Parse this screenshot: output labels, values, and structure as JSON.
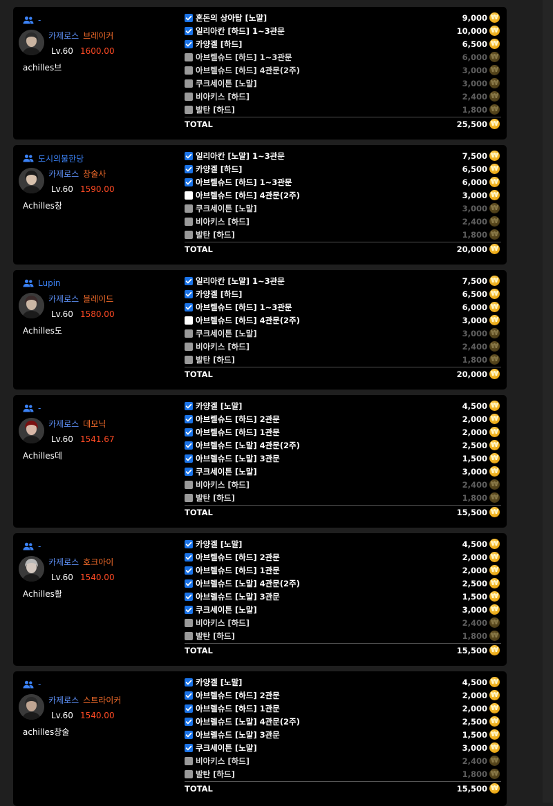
{
  "icons": {
    "party": "party-icon",
    "coin": "gold-coin-icon",
    "check": "check-icon"
  },
  "colors": {
    "server": "#5b8cf0",
    "class": "#f26b2a",
    "item_level": "#ff4a24",
    "party": "#3b82f6",
    "checkbox": "#1a73e8",
    "background": "#000000"
  },
  "characters": [
    {
      "party": "-",
      "server": "카제로스",
      "class": "브레이커",
      "level": "Lv.60",
      "item_level": "1600.00",
      "name": "achilles브",
      "raids": [
        {
          "name": "혼돈의 상아탑 [노말]",
          "gold": "9,000",
          "state": "checked"
        },
        {
          "name": "일리아칸 [하드] 1~3관문",
          "gold": "10,000",
          "state": "checked"
        },
        {
          "name": "카양겔 [하드]",
          "gold": "6,500",
          "state": "checked"
        },
        {
          "name": "아브렐슈드 [하드] 1~3관문",
          "gold": "6,000",
          "state": "disabled"
        },
        {
          "name": "아브렐슈드 [하드] 4관문(2주)",
          "gold": "3,000",
          "state": "disabled"
        },
        {
          "name": "쿠크세이튼 [노말]",
          "gold": "3,000",
          "state": "disabled"
        },
        {
          "name": "비아키스 [하드]",
          "gold": "2,400",
          "state": "disabled"
        },
        {
          "name": "발탄 [하드]",
          "gold": "1,800",
          "state": "disabled"
        }
      ],
      "total_label": "TOTAL",
      "total": "25,500"
    },
    {
      "party": "도시의불한당",
      "server": "카제로스",
      "class": "창술사",
      "level": "Lv.60",
      "item_level": "1590.00",
      "name": "Achilles창",
      "raids": [
        {
          "name": "일리아칸 [노말] 1~3관문",
          "gold": "7,500",
          "state": "checked"
        },
        {
          "name": "카양겔 [하드]",
          "gold": "6,500",
          "state": "checked"
        },
        {
          "name": "아브렐슈드 [하드] 1~3관문",
          "gold": "6,000",
          "state": "checked"
        },
        {
          "name": "아브렐슈드 [하드] 4관문(2주)",
          "gold": "3,000",
          "state": "unchecked"
        },
        {
          "name": "쿠크세이튼 [노말]",
          "gold": "3,000",
          "state": "disabled"
        },
        {
          "name": "비아키스 [하드]",
          "gold": "2,400",
          "state": "disabled"
        },
        {
          "name": "발탄 [하드]",
          "gold": "1,800",
          "state": "disabled"
        }
      ],
      "total_label": "TOTAL",
      "total": "20,000"
    },
    {
      "party": "Lupin",
      "server": "카제로스",
      "class": "블레이드",
      "level": "Lv.60",
      "item_level": "1580.00",
      "name": "Achilles도",
      "raids": [
        {
          "name": "일리아칸 [노말] 1~3관문",
          "gold": "7,500",
          "state": "checked"
        },
        {
          "name": "카양겔 [하드]",
          "gold": "6,500",
          "state": "checked"
        },
        {
          "name": "아브렐슈드 [하드] 1~3관문",
          "gold": "6,000",
          "state": "checked"
        },
        {
          "name": "아브렐슈드 [하드] 4관문(2주)",
          "gold": "3,000",
          "state": "unchecked"
        },
        {
          "name": "쿠크세이튼 [노말]",
          "gold": "3,000",
          "state": "disabled"
        },
        {
          "name": "비아키스 [하드]",
          "gold": "2,400",
          "state": "disabled"
        },
        {
          "name": "발탄 [하드]",
          "gold": "1,800",
          "state": "disabled"
        }
      ],
      "total_label": "TOTAL",
      "total": "20,000"
    },
    {
      "party": "-",
      "server": "카제로스",
      "class": "데모닉",
      "level": "Lv.60",
      "item_level": "1541.67",
      "name": "Achilles데",
      "raids": [
        {
          "name": "카양겔 [노말]",
          "gold": "4,500",
          "state": "checked"
        },
        {
          "name": "아브렐슈드 [하드] 2관문",
          "gold": "2,000",
          "state": "checked"
        },
        {
          "name": "아브렐슈드 [하드] 1관문",
          "gold": "2,000",
          "state": "checked"
        },
        {
          "name": "아브렐슈드 [노말] 4관문(2주)",
          "gold": "2,500",
          "state": "checked"
        },
        {
          "name": "아브렐슈드 [노말] 3관문",
          "gold": "1,500",
          "state": "checked"
        },
        {
          "name": "쿠크세이튼 [노말]",
          "gold": "3,000",
          "state": "checked"
        },
        {
          "name": "비아키스 [하드]",
          "gold": "2,400",
          "state": "disabled"
        },
        {
          "name": "발탄 [하드]",
          "gold": "1,800",
          "state": "disabled"
        }
      ],
      "total_label": "TOTAL",
      "total": "15,500"
    },
    {
      "party": "-",
      "server": "카제로스",
      "class": "호크아이",
      "level": "Lv.60",
      "item_level": "1540.00",
      "name": "Achilles활",
      "raids": [
        {
          "name": "카양겔 [노말]",
          "gold": "4,500",
          "state": "checked"
        },
        {
          "name": "아브렐슈드 [하드] 2관문",
          "gold": "2,000",
          "state": "checked"
        },
        {
          "name": "아브렐슈드 [하드] 1관문",
          "gold": "2,000",
          "state": "checked"
        },
        {
          "name": "아브렐슈드 [노말] 4관문(2주)",
          "gold": "2,500",
          "state": "checked"
        },
        {
          "name": "아브렐슈드 [노말] 3관문",
          "gold": "1,500",
          "state": "checked"
        },
        {
          "name": "쿠크세이튼 [노말]",
          "gold": "3,000",
          "state": "checked"
        },
        {
          "name": "비아키스 [하드]",
          "gold": "2,400",
          "state": "disabled"
        },
        {
          "name": "발탄 [하드]",
          "gold": "1,800",
          "state": "disabled"
        }
      ],
      "total_label": "TOTAL",
      "total": "15,500"
    },
    {
      "party": "-",
      "server": "카제로스",
      "class": "스트라이커",
      "level": "Lv.60",
      "item_level": "1540.00",
      "name": "achilles창술",
      "raids": [
        {
          "name": "카양겔 [노말]",
          "gold": "4,500",
          "state": "checked"
        },
        {
          "name": "아브렐슈드 [하드] 2관문",
          "gold": "2,000",
          "state": "checked"
        },
        {
          "name": "아브렐슈드 [하드] 1관문",
          "gold": "2,000",
          "state": "checked"
        },
        {
          "name": "아브렐슈드 [노말] 4관문(2주)",
          "gold": "2,500",
          "state": "checked"
        },
        {
          "name": "아브렐슈드 [노말] 3관문",
          "gold": "1,500",
          "state": "checked"
        },
        {
          "name": "쿠크세이튼 [노말]",
          "gold": "3,000",
          "state": "checked"
        },
        {
          "name": "비아키스 [하드]",
          "gold": "2,400",
          "state": "disabled"
        },
        {
          "name": "발탄 [하드]",
          "gold": "1,800",
          "state": "disabled"
        }
      ],
      "total_label": "TOTAL",
      "total": "15,500"
    }
  ]
}
